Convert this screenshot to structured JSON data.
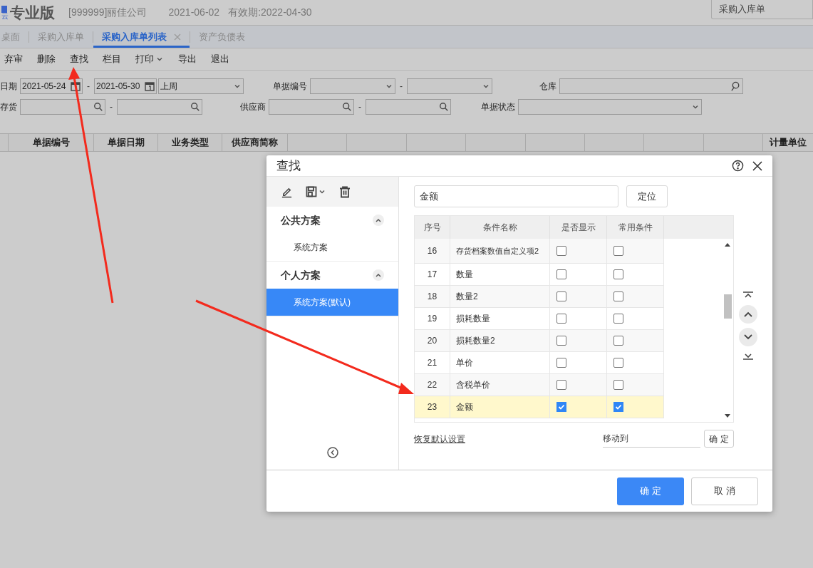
{
  "header": {
    "logo_text": "云",
    "edition": "专业版",
    "company": "[999999]丽佳公司",
    "date": "2021-06-02",
    "validity": "有效期:2022-04-30",
    "search_value": "采购入库单"
  },
  "tabs": [
    {
      "label": "桌面",
      "selected": false,
      "closable": false
    },
    {
      "label": "采购入库单",
      "selected": false,
      "closable": false
    },
    {
      "label": "采购入库单列表",
      "selected": true,
      "closable": true
    },
    {
      "label": "资产负债表",
      "selected": false,
      "closable": false
    }
  ],
  "toolbar": [
    {
      "label": "弃审",
      "dropdown": false
    },
    {
      "label": "删除",
      "dropdown": false
    },
    {
      "label": "查找",
      "dropdown": false
    },
    {
      "label": "栏目",
      "dropdown": false
    },
    {
      "label": "打印",
      "dropdown": true
    },
    {
      "label": "导出",
      "dropdown": false
    },
    {
      "label": "退出",
      "dropdown": false
    }
  ],
  "filters": [
    [
      {
        "label": "日期",
        "separator": "-",
        "fields": [
          {
            "kind": "date",
            "value": "2021-05-24"
          },
          {
            "kind": "date",
            "value": "2021-05-30"
          },
          {
            "kind": "select",
            "value": "上周"
          }
        ]
      },
      {
        "label": "单据编号",
        "separator": "-",
        "fields": [
          {
            "kind": "select"
          },
          {
            "kind": "select"
          }
        ]
      },
      {
        "label": "仓库",
        "fields": [
          {
            "kind": "lookup"
          }
        ]
      }
    ],
    [
      {
        "label": "存货",
        "separator": "-",
        "fields": [
          {
            "kind": "search"
          },
          {
            "kind": "search"
          }
        ]
      },
      {
        "label": "供应商",
        "separator": "-",
        "fields": [
          {
            "kind": "search"
          },
          {
            "kind": "search"
          }
        ]
      },
      {
        "label": "单据状态",
        "fields": [
          {
            "kind": "select"
          }
        ]
      }
    ]
  ],
  "grid": {
    "columns": [
      "单据编号",
      "单据日期",
      "业务类型",
      "供应商简称"
    ],
    "last_column": "计量单位"
  },
  "dialog": {
    "title": "查找",
    "schemes": [
      {
        "label": "公共方案",
        "expanded": true,
        "items": [
          {
            "label": "系统方案",
            "selected": false
          }
        ]
      },
      {
        "label": "个人方案",
        "expanded": true,
        "items": [
          {
            "label": "系统方案(默认)",
            "selected": true
          }
        ]
      }
    ],
    "search_value": "金额",
    "locate_button": "定位",
    "columns": [
      "序号",
      "条件名称",
      "是否显示",
      "常用条件"
    ],
    "rows": [
      {
        "no": "16",
        "name": "存货档案数值自定义项2",
        "shown": false,
        "common": false,
        "selected": false
      },
      {
        "no": "17",
        "name": "数量",
        "shown": false,
        "common": false,
        "selected": false
      },
      {
        "no": "18",
        "name": "数量2",
        "shown": false,
        "common": false,
        "selected": false
      },
      {
        "no": "19",
        "name": "损耗数量",
        "shown": false,
        "common": false,
        "selected": false
      },
      {
        "no": "20",
        "name": "损耗数量2",
        "shown": false,
        "common": false,
        "selected": false
      },
      {
        "no": "21",
        "name": "单价",
        "shown": false,
        "common": false,
        "selected": false
      },
      {
        "no": "22",
        "name": "含税单价",
        "shown": false,
        "common": false,
        "selected": false
      },
      {
        "no": "23",
        "name": "金额",
        "shown": true,
        "common": true,
        "selected": true
      }
    ],
    "restore_link": "恢复默认设置",
    "move_to_placeholder": "移动到",
    "move_button": "确 定",
    "ok_button": "确 定",
    "cancel_button": "取 消"
  }
}
